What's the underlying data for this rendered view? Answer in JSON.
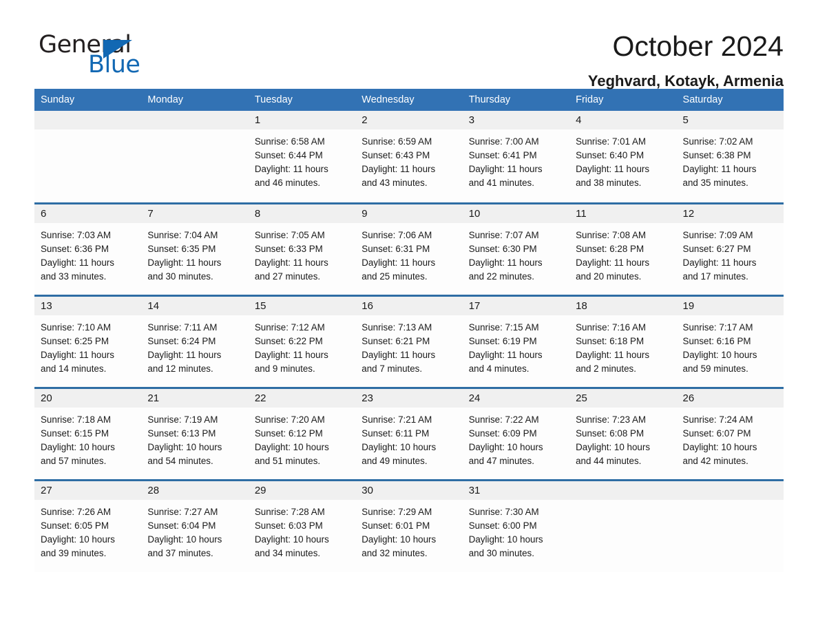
{
  "brand": {
    "name_part1": "General",
    "name_part2": "Blue",
    "accent_color": "#1268b3"
  },
  "header": {
    "title": "October 2024",
    "subtitle": "Yeghvard, Kotayk, Armenia"
  },
  "calendar": {
    "header_bg": "#3272b4",
    "row_divider_color": "#2e6da4",
    "daynum_bg": "#f0f0f0",
    "weekday_headers": [
      "Sunday",
      "Monday",
      "Tuesday",
      "Wednesday",
      "Thursday",
      "Friday",
      "Saturday"
    ],
    "weeks": [
      [
        {
          "day": "",
          "lines": []
        },
        {
          "day": "",
          "lines": []
        },
        {
          "day": "1",
          "lines": [
            "Sunrise: 6:58 AM",
            "Sunset: 6:44 PM",
            "Daylight: 11 hours",
            "and 46 minutes."
          ]
        },
        {
          "day": "2",
          "lines": [
            "Sunrise: 6:59 AM",
            "Sunset: 6:43 PM",
            "Daylight: 11 hours",
            "and 43 minutes."
          ]
        },
        {
          "day": "3",
          "lines": [
            "Sunrise: 7:00 AM",
            "Sunset: 6:41 PM",
            "Daylight: 11 hours",
            "and 41 minutes."
          ]
        },
        {
          "day": "4",
          "lines": [
            "Sunrise: 7:01 AM",
            "Sunset: 6:40 PM",
            "Daylight: 11 hours",
            "and 38 minutes."
          ]
        },
        {
          "day": "5",
          "lines": [
            "Sunrise: 7:02 AM",
            "Sunset: 6:38 PM",
            "Daylight: 11 hours",
            "and 35 minutes."
          ]
        }
      ],
      [
        {
          "day": "6",
          "lines": [
            "Sunrise: 7:03 AM",
            "Sunset: 6:36 PM",
            "Daylight: 11 hours",
            "and 33 minutes."
          ]
        },
        {
          "day": "7",
          "lines": [
            "Sunrise: 7:04 AM",
            "Sunset: 6:35 PM",
            "Daylight: 11 hours",
            "and 30 minutes."
          ]
        },
        {
          "day": "8",
          "lines": [
            "Sunrise: 7:05 AM",
            "Sunset: 6:33 PM",
            "Daylight: 11 hours",
            "and 27 minutes."
          ]
        },
        {
          "day": "9",
          "lines": [
            "Sunrise: 7:06 AM",
            "Sunset: 6:31 PM",
            "Daylight: 11 hours",
            "and 25 minutes."
          ]
        },
        {
          "day": "10",
          "lines": [
            "Sunrise: 7:07 AM",
            "Sunset: 6:30 PM",
            "Daylight: 11 hours",
            "and 22 minutes."
          ]
        },
        {
          "day": "11",
          "lines": [
            "Sunrise: 7:08 AM",
            "Sunset: 6:28 PM",
            "Daylight: 11 hours",
            "and 20 minutes."
          ]
        },
        {
          "day": "12",
          "lines": [
            "Sunrise: 7:09 AM",
            "Sunset: 6:27 PM",
            "Daylight: 11 hours",
            "and 17 minutes."
          ]
        }
      ],
      [
        {
          "day": "13",
          "lines": [
            "Sunrise: 7:10 AM",
            "Sunset: 6:25 PM",
            "Daylight: 11 hours",
            "and 14 minutes."
          ]
        },
        {
          "day": "14",
          "lines": [
            "Sunrise: 7:11 AM",
            "Sunset: 6:24 PM",
            "Daylight: 11 hours",
            "and 12 minutes."
          ]
        },
        {
          "day": "15",
          "lines": [
            "Sunrise: 7:12 AM",
            "Sunset: 6:22 PM",
            "Daylight: 11 hours",
            "and 9 minutes."
          ]
        },
        {
          "day": "16",
          "lines": [
            "Sunrise: 7:13 AM",
            "Sunset: 6:21 PM",
            "Daylight: 11 hours",
            "and 7 minutes."
          ]
        },
        {
          "day": "17",
          "lines": [
            "Sunrise: 7:15 AM",
            "Sunset: 6:19 PM",
            "Daylight: 11 hours",
            "and 4 minutes."
          ]
        },
        {
          "day": "18",
          "lines": [
            "Sunrise: 7:16 AM",
            "Sunset: 6:18 PM",
            "Daylight: 11 hours",
            "and 2 minutes."
          ]
        },
        {
          "day": "19",
          "lines": [
            "Sunrise: 7:17 AM",
            "Sunset: 6:16 PM",
            "Daylight: 10 hours",
            "and 59 minutes."
          ]
        }
      ],
      [
        {
          "day": "20",
          "lines": [
            "Sunrise: 7:18 AM",
            "Sunset: 6:15 PM",
            "Daylight: 10 hours",
            "and 57 minutes."
          ]
        },
        {
          "day": "21",
          "lines": [
            "Sunrise: 7:19 AM",
            "Sunset: 6:13 PM",
            "Daylight: 10 hours",
            "and 54 minutes."
          ]
        },
        {
          "day": "22",
          "lines": [
            "Sunrise: 7:20 AM",
            "Sunset: 6:12 PM",
            "Daylight: 10 hours",
            "and 51 minutes."
          ]
        },
        {
          "day": "23",
          "lines": [
            "Sunrise: 7:21 AM",
            "Sunset: 6:11 PM",
            "Daylight: 10 hours",
            "and 49 minutes."
          ]
        },
        {
          "day": "24",
          "lines": [
            "Sunrise: 7:22 AM",
            "Sunset: 6:09 PM",
            "Daylight: 10 hours",
            "and 47 minutes."
          ]
        },
        {
          "day": "25",
          "lines": [
            "Sunrise: 7:23 AM",
            "Sunset: 6:08 PM",
            "Daylight: 10 hours",
            "and 44 minutes."
          ]
        },
        {
          "day": "26",
          "lines": [
            "Sunrise: 7:24 AM",
            "Sunset: 6:07 PM",
            "Daylight: 10 hours",
            "and 42 minutes."
          ]
        }
      ],
      [
        {
          "day": "27",
          "lines": [
            "Sunrise: 7:26 AM",
            "Sunset: 6:05 PM",
            "Daylight: 10 hours",
            "and 39 minutes."
          ]
        },
        {
          "day": "28",
          "lines": [
            "Sunrise: 7:27 AM",
            "Sunset: 6:04 PM",
            "Daylight: 10 hours",
            "and 37 minutes."
          ]
        },
        {
          "day": "29",
          "lines": [
            "Sunrise: 7:28 AM",
            "Sunset: 6:03 PM",
            "Daylight: 10 hours",
            "and 34 minutes."
          ]
        },
        {
          "day": "30",
          "lines": [
            "Sunrise: 7:29 AM",
            "Sunset: 6:01 PM",
            "Daylight: 10 hours",
            "and 32 minutes."
          ]
        },
        {
          "day": "31",
          "lines": [
            "Sunrise: 7:30 AM",
            "Sunset: 6:00 PM",
            "Daylight: 10 hours",
            "and 30 minutes."
          ]
        },
        {
          "day": "",
          "lines": []
        },
        {
          "day": "",
          "lines": []
        }
      ]
    ]
  }
}
